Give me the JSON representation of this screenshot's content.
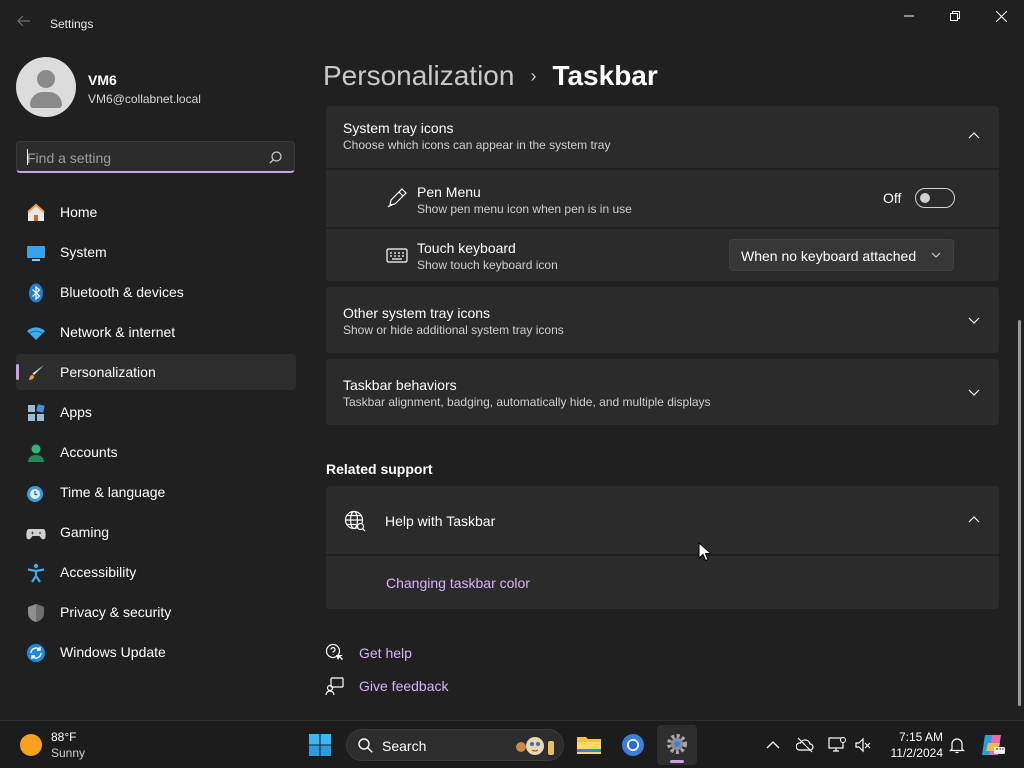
{
  "window": {
    "title": "Settings"
  },
  "profile": {
    "name": "VM6",
    "email": "VM6@collabnet.local"
  },
  "search": {
    "placeholder": "Find a setting"
  },
  "sidebar": {
    "items": [
      {
        "label": "Home",
        "icon": "home-icon"
      },
      {
        "label": "System",
        "icon": "system-icon"
      },
      {
        "label": "Bluetooth & devices",
        "icon": "bluetooth-icon"
      },
      {
        "label": "Network & internet",
        "icon": "wifi-icon"
      },
      {
        "label": "Personalization",
        "icon": "brush-icon",
        "selected": true
      },
      {
        "label": "Apps",
        "icon": "apps-icon"
      },
      {
        "label": "Accounts",
        "icon": "accounts-icon"
      },
      {
        "label": "Time & language",
        "icon": "clock-globe-icon"
      },
      {
        "label": "Gaming",
        "icon": "gamepad-icon"
      },
      {
        "label": "Accessibility",
        "icon": "accessibility-icon"
      },
      {
        "label": "Privacy & security",
        "icon": "shield-icon"
      },
      {
        "label": "Windows Update",
        "icon": "update-icon"
      }
    ]
  },
  "breadcrumb": {
    "parent": "Personalization",
    "separator": "›",
    "current": "Taskbar"
  },
  "system_tray": {
    "title": "System tray icons",
    "subtitle": "Choose which icons can appear in the system tray",
    "pen_menu": {
      "title": "Pen Menu",
      "subtitle": "Show pen menu icon when pen is in use",
      "state": "Off",
      "on": false
    },
    "touch_keyboard": {
      "title": "Touch keyboard",
      "subtitle": "Show touch keyboard icon",
      "value": "When no keyboard attached"
    }
  },
  "other_tray": {
    "title": "Other system tray icons",
    "subtitle": "Show or hide additional system tray icons"
  },
  "behaviors": {
    "title": "Taskbar behaviors",
    "subtitle": "Taskbar alignment, badging, automatically hide, and multiple displays"
  },
  "related_support": {
    "heading": "Related support",
    "help_title": "Help with Taskbar",
    "link": "Changing taskbar color"
  },
  "footer_links": {
    "get_help": "Get help",
    "give_feedback": "Give feedback"
  },
  "taskbar": {
    "weather_temp": "88°F",
    "weather_desc": "Sunny",
    "search_label": "Search",
    "time": "7:15 AM",
    "date": "11/2/2024"
  },
  "colors": {
    "accent": "#c7a2e8",
    "link": "#d8b4f8",
    "background": "#202020",
    "card": "#2b2b2b"
  }
}
